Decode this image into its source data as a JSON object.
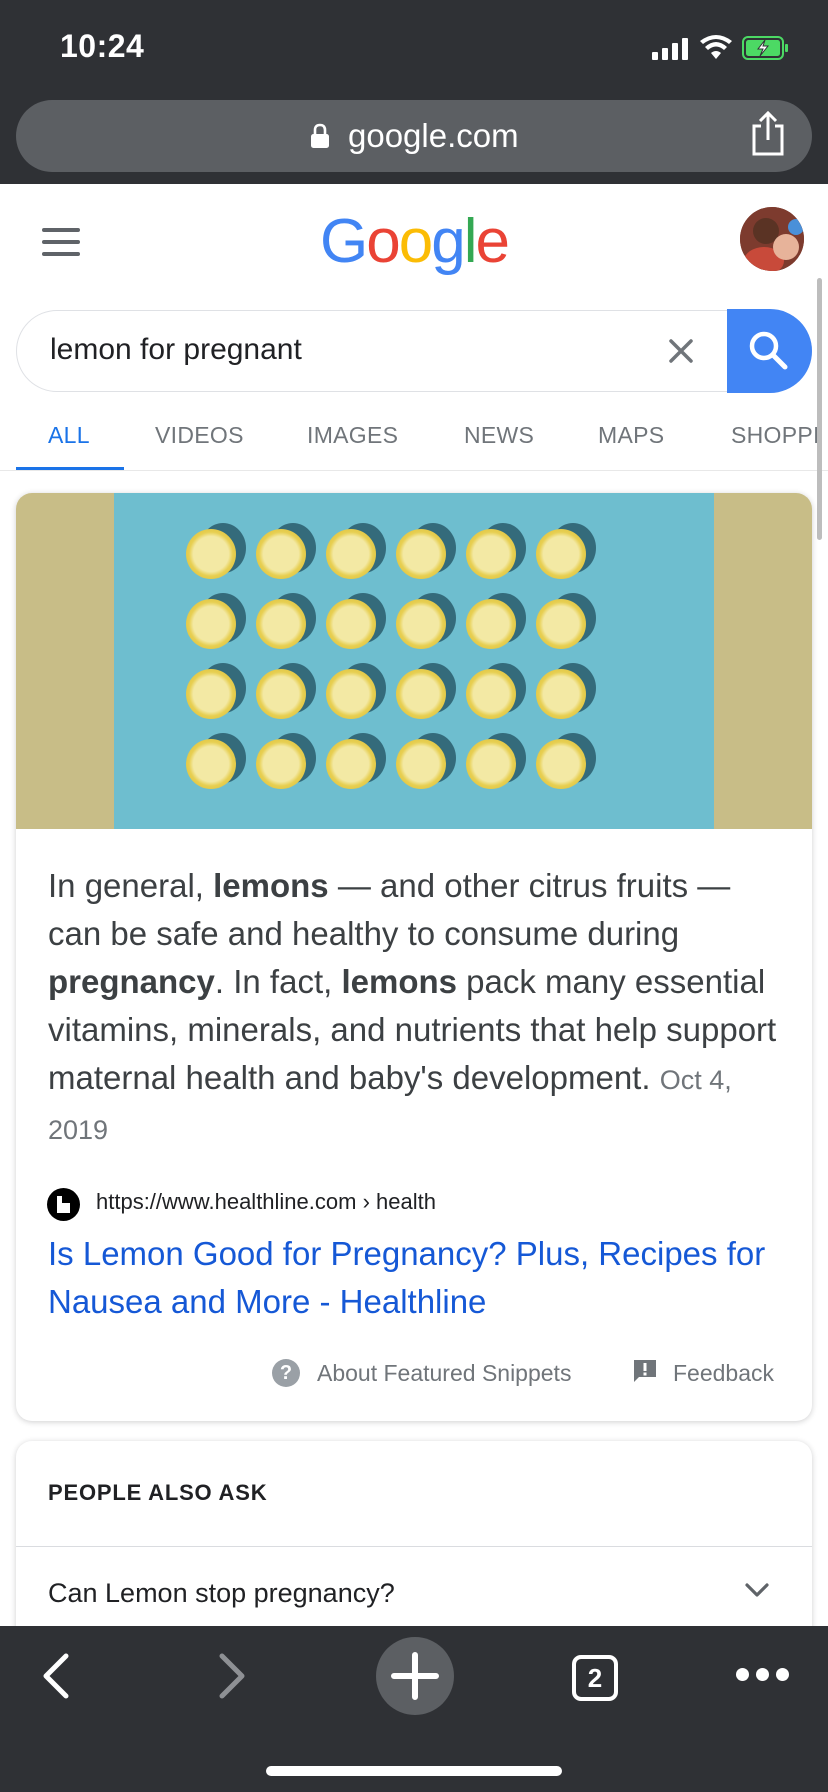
{
  "status_bar": {
    "time": "10:24"
  },
  "browser": {
    "url": "google.com",
    "share_icon": "share-icon",
    "lock_icon": "lock-icon"
  },
  "header": {
    "menu_icon": "hamburger-menu-icon",
    "logo": [
      "G",
      "o",
      "o",
      "g",
      "l",
      "e"
    ],
    "logo_colors": [
      "#4285f4",
      "#ea4335",
      "#fbbc05",
      "#4285f4",
      "#34a853",
      "#ea4335"
    ],
    "avatar": "account-avatar"
  },
  "search": {
    "query": "lemon for pregnant",
    "clear_icon": "close-icon",
    "submit_icon": "search-icon",
    "accent": "#4285f4"
  },
  "tabs": [
    {
      "label": "ALL",
      "active": true
    },
    {
      "label": "VIDEOS"
    },
    {
      "label": "IMAGES"
    },
    {
      "label": "NEWS"
    },
    {
      "label": "MAPS"
    },
    {
      "label": "SHOPPI"
    }
  ],
  "featured_snippet": {
    "text_parts": [
      "In general, ",
      "lemons",
      " — and other citrus fruits — can be safe and healthy to consume during ",
      "pregnancy",
      ". In fact, ",
      "lemons",
      " pack many essential vitamins, minerals, and nutrients that help support maternal health and baby's development. "
    ],
    "date": "Oct 4, 2019",
    "source_url": "https://www.healthline.com › health",
    "result_title": "Is Lemon Good for Pregnancy? Plus, Recipes for Nausea and More - Healthline",
    "about_label": "About Featured Snippets",
    "feedback_label": "Feedback"
  },
  "people_also_ask": {
    "title": "PEOPLE ALSO ASK",
    "questions": [
      "Can Lemon stop pregnancy?"
    ]
  },
  "toolbar": {
    "tab_count": "2",
    "icons": [
      "back-icon",
      "forward-icon",
      "new-tab-icon",
      "tabs-icon",
      "more-icon"
    ]
  }
}
